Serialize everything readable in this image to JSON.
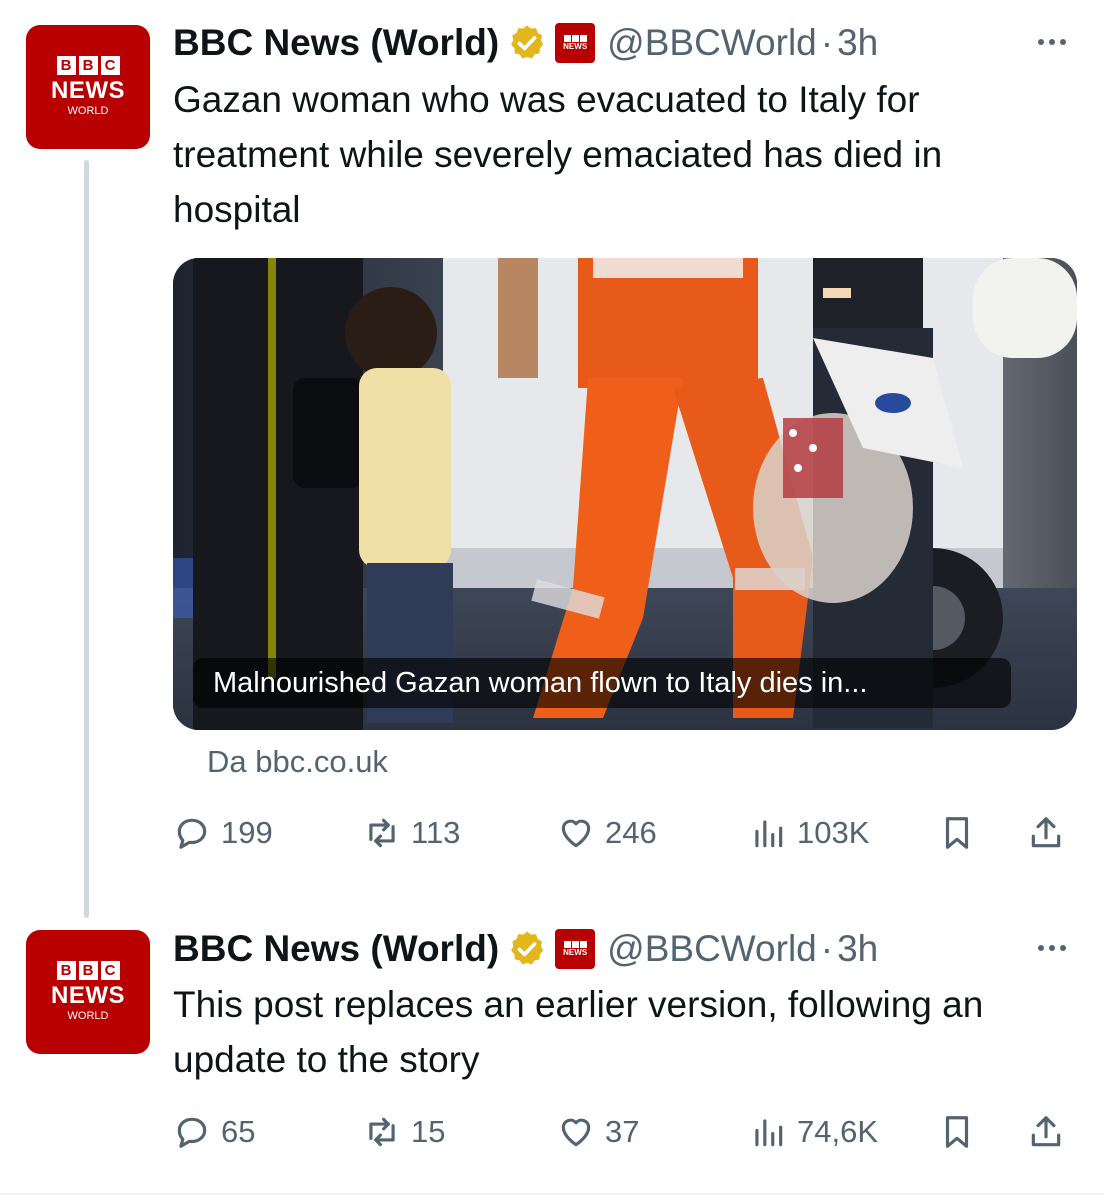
{
  "tweets": [
    {
      "author": {
        "name": "BBC News (World)",
        "handle": "@BBCWorld",
        "time": "3h",
        "avatar": {
          "letters": [
            "B",
            "B",
            "C"
          ],
          "line1": "NEWS",
          "line2": "WORLD"
        },
        "badge": "verified-gold-icon",
        "affiliate": {
          "letters": [
            "B",
            "B",
            "C"
          ],
          "text": "NEWS"
        }
      },
      "text": "Gazan woman who was evacuated to Italy for treatment while severely emaciated has died in hospital",
      "card": {
        "caption": "Malnourished Gazan woman flown to Italy dies in...",
        "source": "Da bbc.co.uk"
      },
      "stats": {
        "replies": "199",
        "reposts": "113",
        "likes": "246",
        "views": "103K"
      }
    },
    {
      "author": {
        "name": "BBC News (World)",
        "handle": "@BBCWorld",
        "time": "3h",
        "avatar": {
          "letters": [
            "B",
            "B",
            "C"
          ],
          "line1": "NEWS",
          "line2": "WORLD"
        },
        "badge": "verified-gold-icon",
        "affiliate": {
          "letters": [
            "B",
            "B",
            "C"
          ],
          "text": "NEWS"
        }
      },
      "text": "This post replaces an earlier version, following an update to the story",
      "stats": {
        "replies": "65",
        "reposts": "15",
        "likes": "37",
        "views": "74,6K"
      }
    }
  ],
  "separator": "·",
  "colors": {
    "brand_red": "#b80000",
    "verified_gold": "#e2b719",
    "muted": "#536471",
    "text": "#0f1419"
  }
}
